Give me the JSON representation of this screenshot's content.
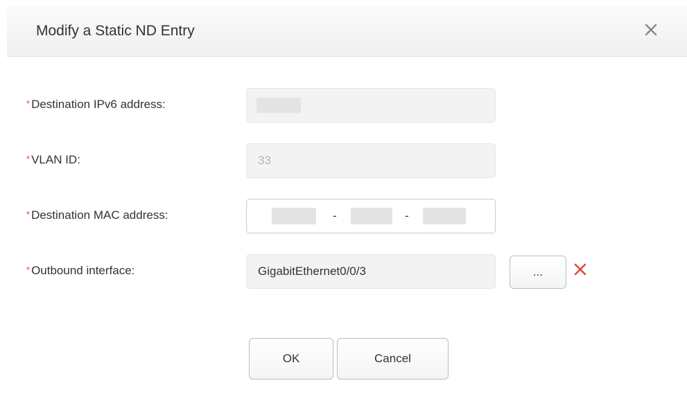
{
  "dialog": {
    "title": "Modify a Static ND Entry",
    "close_icon": "close-icon"
  },
  "form": {
    "required_marker": "*",
    "ipv6": {
      "label": "Destination IPv6 address:",
      "value": ""
    },
    "vlan": {
      "label": "VLAN ID:",
      "value": "33"
    },
    "mac": {
      "label": "Destination MAC address:",
      "separator": "-"
    },
    "outbound": {
      "label": "Outbound interface:",
      "value": "GigabitEthernet0/0/3",
      "browse_label": "...",
      "remove_icon": "x-icon"
    }
  },
  "buttons": {
    "ok": "OK",
    "cancel": "Cancel"
  },
  "colors": {
    "required": "#e24a3b",
    "remove": "#e24a3b"
  }
}
